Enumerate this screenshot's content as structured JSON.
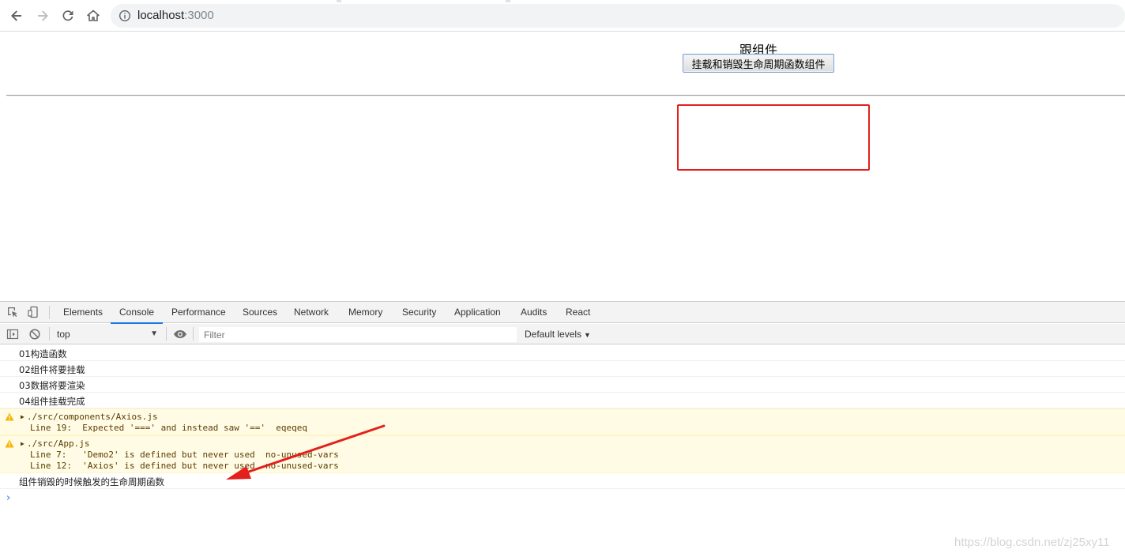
{
  "browser": {
    "url_host": "localhost",
    "url_port": ":3000"
  },
  "page": {
    "root_title": "跟组件",
    "toggle_button": "挂载和销毁生命周期函数组件"
  },
  "devtools": {
    "tabs": [
      "Elements",
      "Console",
      "Performance",
      "Sources",
      "Network",
      "Memory",
      "Security",
      "Application",
      "Audits",
      "React"
    ],
    "active_tab": "Console",
    "context": "top",
    "filter_placeholder": "Filter",
    "levels": "Default levels",
    "console": {
      "logs": [
        "01构造函数",
        "02组件将要挂载",
        "03数据将要渲染",
        "04组件挂载完成"
      ],
      "warnings": [
        {
          "file": "./src/components/Axios.js",
          "lines": [
            "Line 19:  Expected '===' and instead saw '=='  eqeqeq"
          ]
        },
        {
          "file": "./src/App.js",
          "lines": [
            "Line 7:   'Demo2' is defined but never used  no-unused-vars",
            "Line 12:  'Axios' is defined but never used  no-unused-vars"
          ]
        }
      ],
      "unmount_log": "组件销毁的时候触发的生命周期函数"
    }
  },
  "watermark": "https://blog.csdn.net/zj25xy11",
  "colors": {
    "annotation_red": "#e3201b",
    "active_tab_underline": "#1a73e8",
    "warning_bg": "#fffbe5"
  },
  "icons": [
    "back-arrow-icon",
    "forward-arrow-icon",
    "reload-icon",
    "home-icon",
    "info-icon",
    "inspect-element-icon",
    "device-toolbar-icon",
    "sidebar-toggle-icon",
    "clear-console-icon",
    "eye-icon",
    "warning-icon"
  ]
}
